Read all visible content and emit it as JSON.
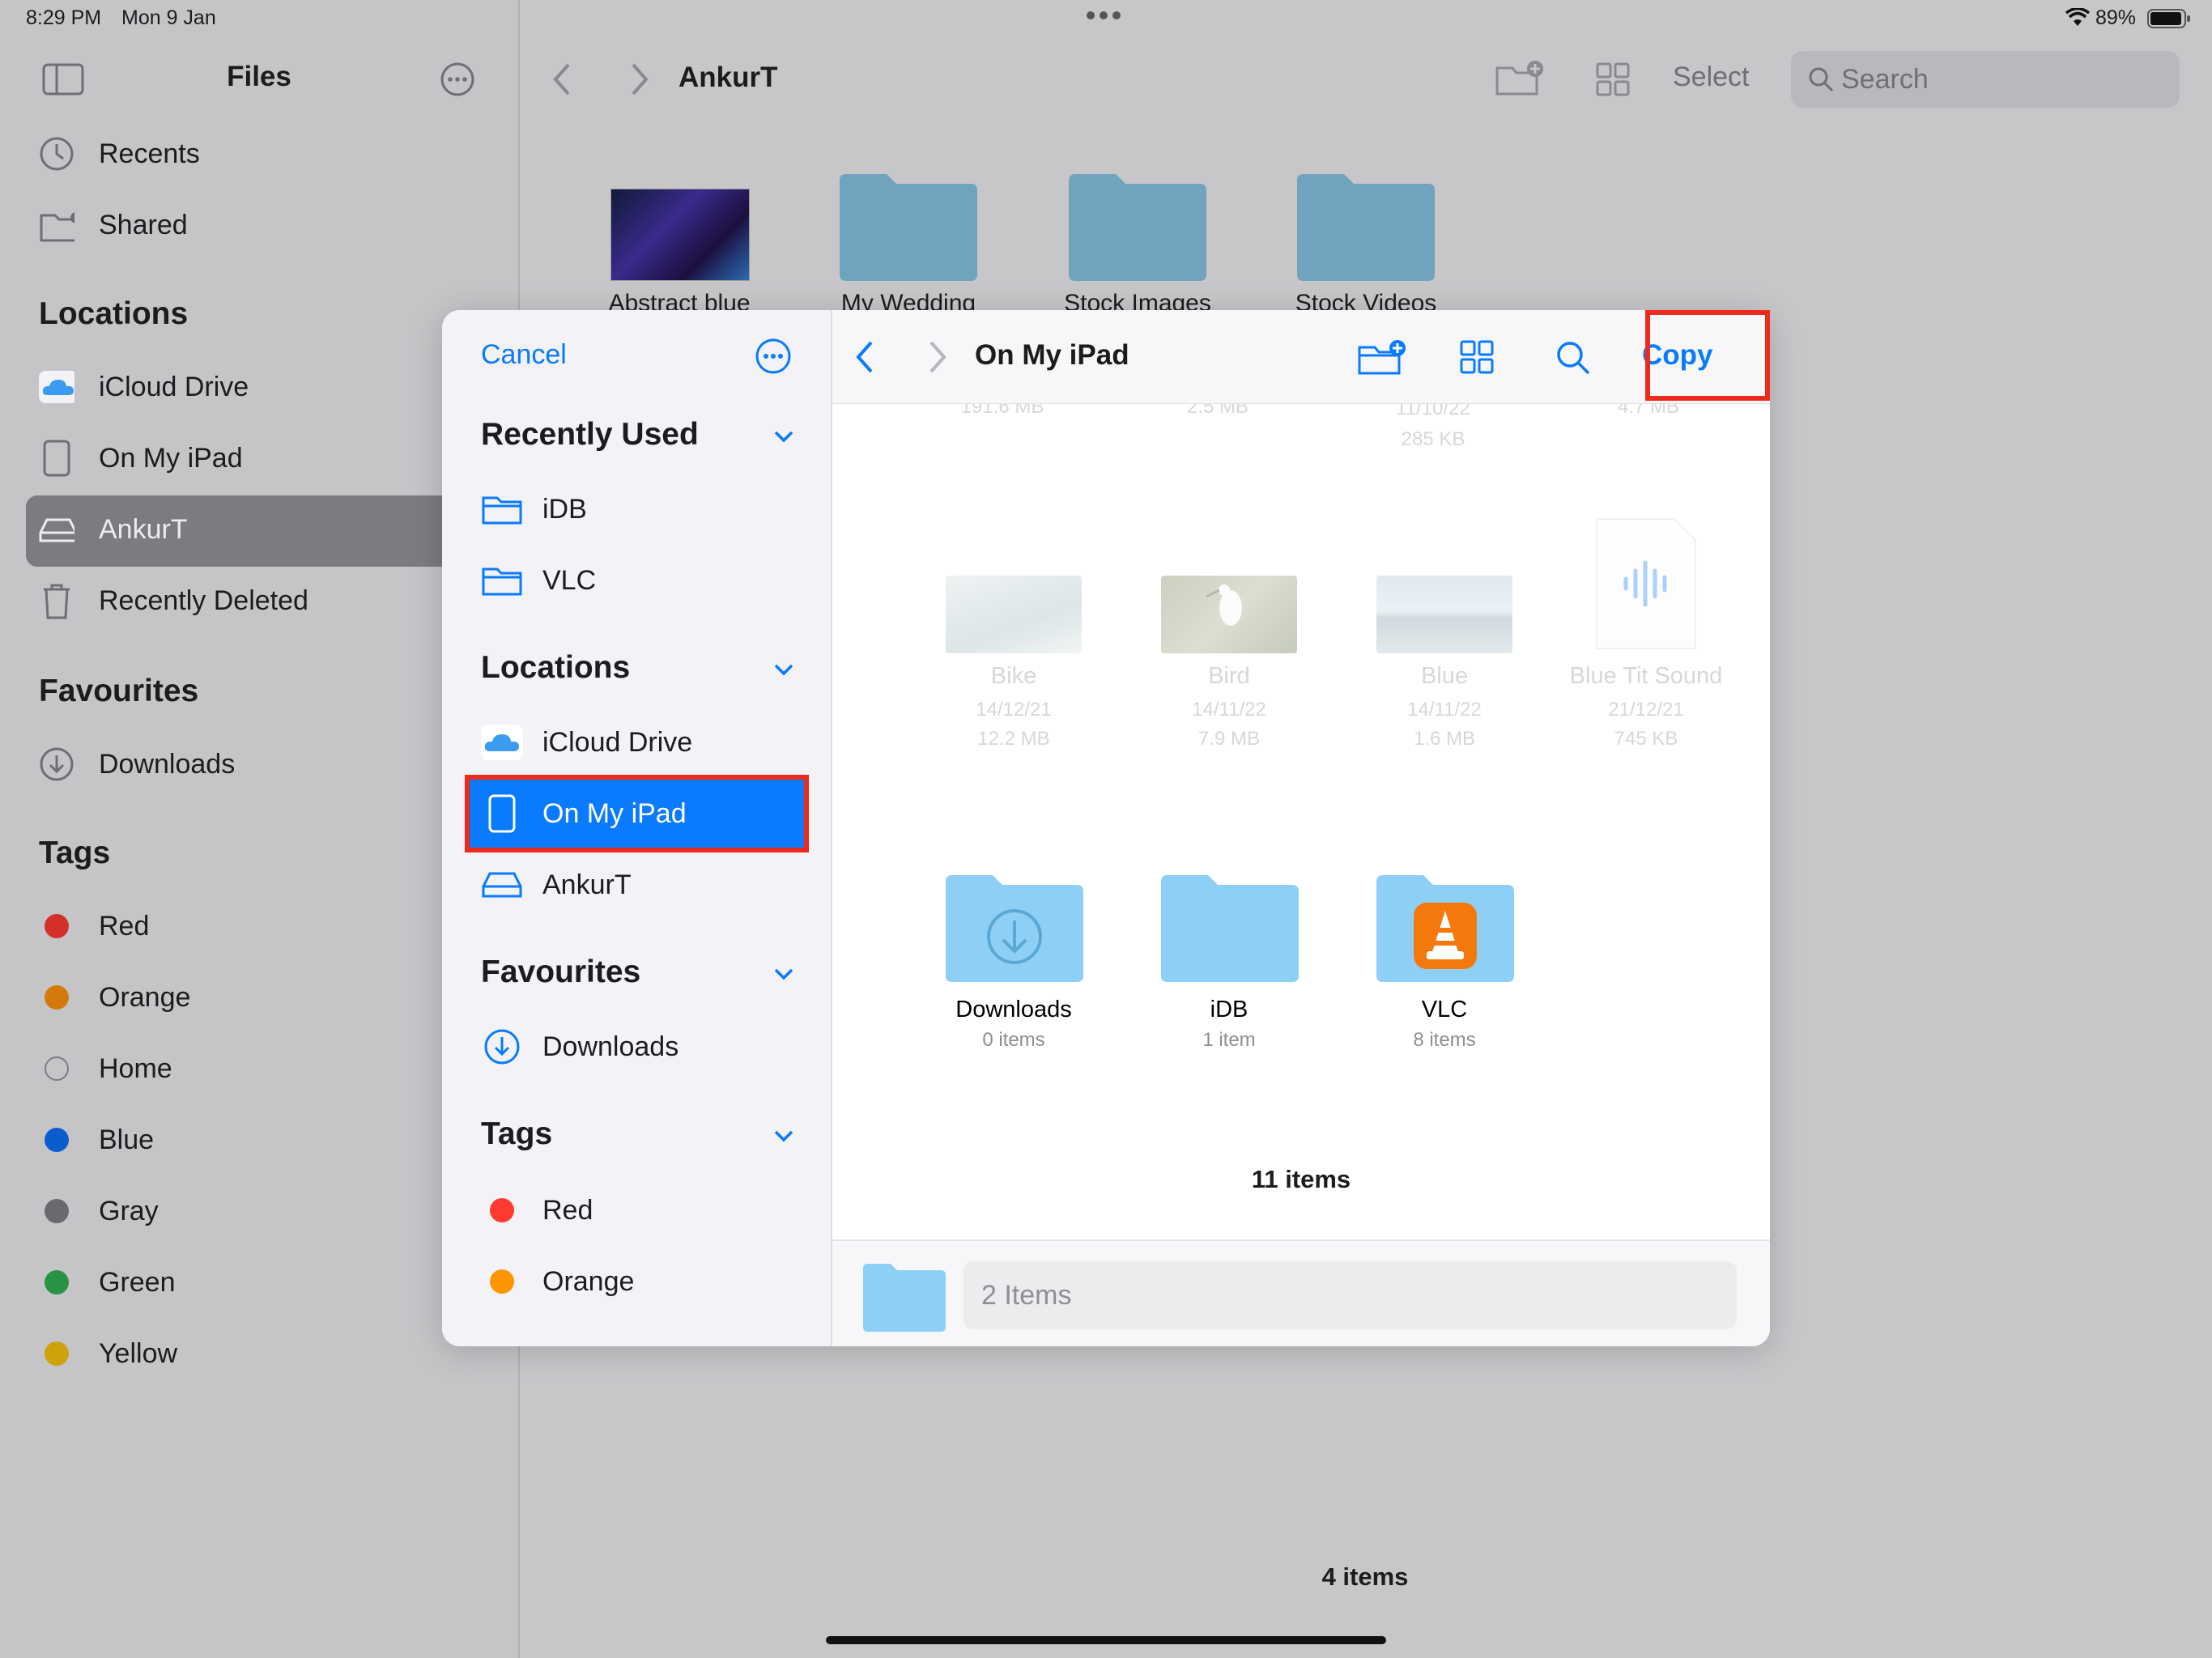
{
  "status_bar": {
    "time": "8:29 PM",
    "date": "Mon 9 Jan",
    "battery": "89%"
  },
  "background": {
    "sidebar_title": "Files",
    "top_items": [
      {
        "label": "Recents",
        "icon": "clock-icon"
      },
      {
        "label": "Shared",
        "icon": "shared-folder-icon"
      }
    ],
    "locations_heading": "Locations",
    "locations": [
      {
        "label": "iCloud Drive",
        "icon": "icloud-icon"
      },
      {
        "label": "On My iPad",
        "icon": "ipad-icon"
      },
      {
        "label": "AnkurT",
        "icon": "drive-icon"
      },
      {
        "label": "Recently Deleted",
        "icon": "trash-icon"
      }
    ],
    "favourites_heading": "Favourites",
    "favourites": [
      {
        "label": "Downloads",
        "icon": "download-icon"
      }
    ],
    "tags_heading": "Tags",
    "tags": [
      {
        "label": "Red",
        "color": "#e0302a"
      },
      {
        "label": "Orange",
        "color": "#e8850c"
      },
      {
        "label": "Home",
        "color": "none"
      },
      {
        "label": "Blue",
        "color": "#0a64e0"
      },
      {
        "label": "Gray",
        "color": "#7a7a7e"
      },
      {
        "label": "Green",
        "color": "#2ca24a"
      },
      {
        "label": "Yellow",
        "color": "#e0b20c"
      }
    ],
    "nav_title": "AnkurT",
    "select_label": "Select",
    "search_placeholder": "Search",
    "files": [
      {
        "label": "Abstract blue"
      },
      {
        "label": "My Wedding"
      },
      {
        "label": "Stock Images"
      },
      {
        "label": "Stock Videos"
      }
    ],
    "item_count": "4 items"
  },
  "modal": {
    "cancel_label": "Cancel",
    "recently_used_heading": "Recently Used",
    "recently_used": [
      {
        "label": "iDB"
      },
      {
        "label": "VLC"
      }
    ],
    "locations_heading": "Locations",
    "locations": [
      {
        "label": "iCloud Drive"
      },
      {
        "label": "On My iPad"
      },
      {
        "label": "AnkurT"
      }
    ],
    "favourites_heading": "Favourites",
    "favourites": [
      {
        "label": "Downloads"
      }
    ],
    "tags_heading": "Tags",
    "tags": [
      {
        "label": "Red",
        "color": "#ff3b30"
      },
      {
        "label": "Orange",
        "color": "#ff9500"
      }
    ],
    "title": "On My iPad",
    "copy_label": "Copy",
    "top_row_meta": [
      "191.6 MB",
      "2.5 MB",
      "11/10/22",
      "285 KB",
      "4.7 MB"
    ],
    "files": [
      {
        "name": "Bike",
        "date": "14/12/21",
        "size": "12.2 MB"
      },
      {
        "name": "Bird",
        "date": "14/11/22",
        "size": "7.9 MB"
      },
      {
        "name": "Blue",
        "date": "14/11/22",
        "size": "1.6 MB"
      },
      {
        "name": "Blue Tit Sound",
        "date": "21/12/21",
        "size": "745 KB"
      }
    ],
    "folders": [
      {
        "name": "Downloads",
        "count": "0 items"
      },
      {
        "name": "iDB",
        "count": "1 item"
      },
      {
        "name": "VLC",
        "count": "8 items"
      }
    ],
    "item_count": "11 items",
    "name_field": "2 Items"
  }
}
